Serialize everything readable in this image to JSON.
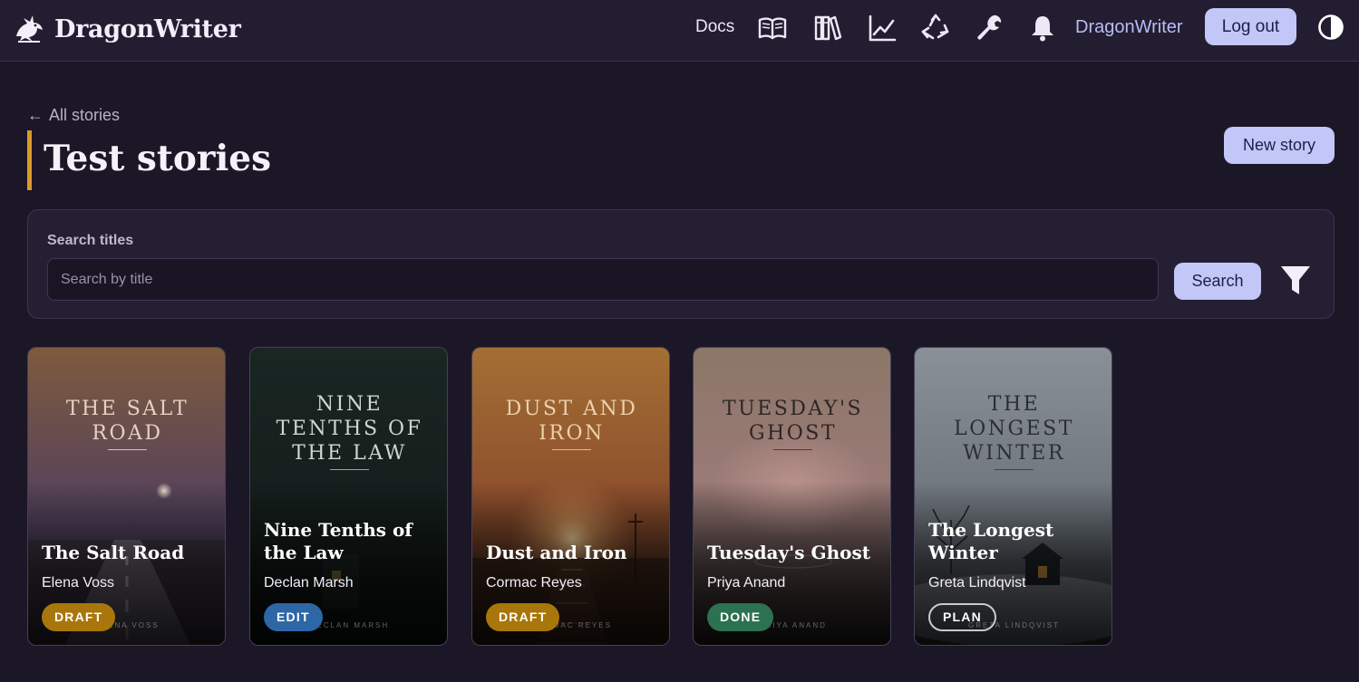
{
  "header": {
    "brand": "DragonWriter",
    "docs_label": "Docs",
    "icons": [
      "book-open-icon",
      "library-icon",
      "chart-line-icon",
      "recycle-icon",
      "wrench-icon",
      "bell-icon"
    ],
    "username": "DragonWriter",
    "logout_label": "Log out",
    "theme_icon": "contrast-icon"
  },
  "page": {
    "back_label": "All stories",
    "title": "Test stories",
    "new_story_label": "New story",
    "accent_color": "#d99a2b"
  },
  "search": {
    "label": "Search titles",
    "placeholder": "Search by title",
    "button_label": "Search",
    "filter_icon": "filter-icon"
  },
  "stories": [
    {
      "cover_title": "The Salt Road",
      "cover_author": "Elena Voss",
      "title": "The Salt Road",
      "author": "Elena Voss",
      "status": "DRAFT",
      "status_color": "#a8760a"
    },
    {
      "cover_title": "Nine Tenths of the Law",
      "cover_author": "Declan Marsh",
      "title": "Nine Tenths of the Law",
      "author": "Declan Marsh",
      "status": "EDIT",
      "status_color": "#2d67a6"
    },
    {
      "cover_title": "Dust and Iron",
      "cover_author": "Cormac Reyes",
      "title": "Dust and Iron",
      "author": "Cormac Reyes",
      "status": "DRAFT",
      "status_color": "#a8760a"
    },
    {
      "cover_title": "Tuesday's Ghost",
      "cover_author": "Priya Anand",
      "title": "Tuesday's Ghost",
      "author": "Priya Anand",
      "status": "DONE",
      "status_color": "#2c7150"
    },
    {
      "cover_title": "The Longest Winter",
      "cover_author": "Greta Lindqvist",
      "title": "The Longest Winter",
      "author": "Greta Lindqvist",
      "status": "PLAN",
      "status_color": "transparent"
    }
  ]
}
